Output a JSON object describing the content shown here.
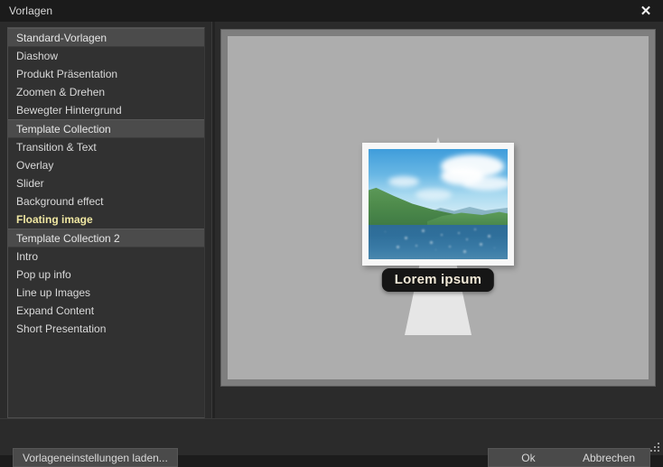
{
  "window": {
    "title": "Vorlagen",
    "close_icon": "close-icon",
    "close_glyph": "✕"
  },
  "sidebar": {
    "items": [
      {
        "label": "Standard-Vorlagen",
        "type": "group"
      },
      {
        "label": "Diashow",
        "type": "item"
      },
      {
        "label": "Produkt Präsentation",
        "type": "item"
      },
      {
        "label": "Zoomen & Drehen",
        "type": "item"
      },
      {
        "label": "Bewegter Hintergrund",
        "type": "item"
      },
      {
        "label": "Template Collection",
        "type": "group"
      },
      {
        "label": "Transition & Text",
        "type": "item"
      },
      {
        "label": "Overlay",
        "type": "item"
      },
      {
        "label": "Slider",
        "type": "item"
      },
      {
        "label": "Background effect",
        "type": "item"
      },
      {
        "label": "Floating image",
        "type": "selected"
      },
      {
        "label": "Template Collection 2",
        "type": "group"
      },
      {
        "label": "Intro",
        "type": "item"
      },
      {
        "label": "Pop up info",
        "type": "item"
      },
      {
        "label": "Line up Images",
        "type": "item"
      },
      {
        "label": "Expand Content",
        "type": "item"
      },
      {
        "label": "Short Presentation",
        "type": "item"
      }
    ]
  },
  "preview": {
    "caption": "Lorem ipsum",
    "scene_name": "floating-image-template-preview",
    "photo_alt": "lake with green hills and blue sky"
  },
  "footer": {
    "load_settings_label": "Vorlageneinstellungen laden...",
    "ok_label": "Ok",
    "cancel_label": "Abbrechen"
  },
  "colors": {
    "window_bg": "#2b2b2b",
    "titlebar_bg": "#1b1b1b",
    "list_bg": "#313131",
    "group_row_bg": "#4b4b4b",
    "selected_text": "#f0e7a2",
    "preview_frame": "#7e7e7e",
    "preview_stage": "#adadad",
    "button_bg": "#4a4a4a"
  }
}
